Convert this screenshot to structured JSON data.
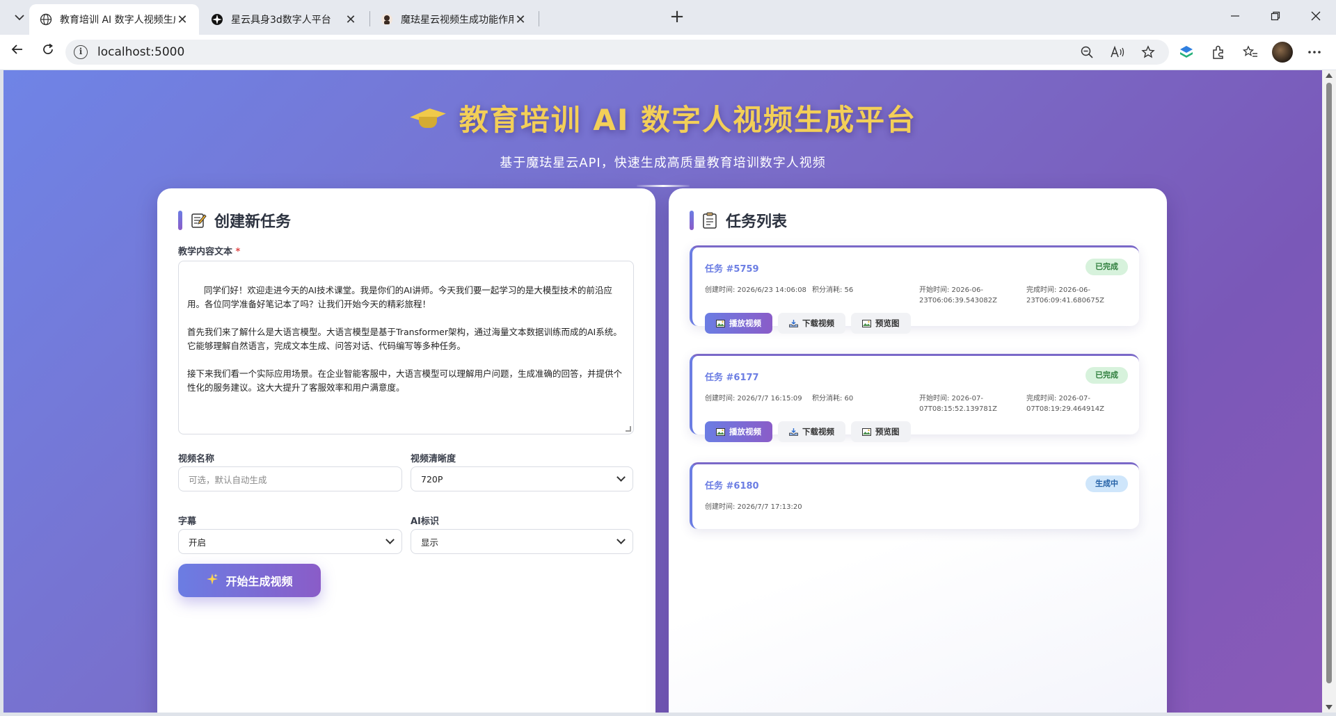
{
  "browser": {
    "tabs": [
      {
        "title": "教育培训 AI 数字人视频生成平台",
        "active": true
      },
      {
        "title": "星云具身3d数字人平台",
        "active": false
      },
      {
        "title": "魔珐星云视频生成功能作用 - 豆包",
        "active": false
      }
    ],
    "url": "localhost:5000"
  },
  "hero": {
    "title": "教育培训 AI 数字人视频生成平台",
    "subtitle": "基于魔珐星云API，快速生成高质量教育培训数字人视频"
  },
  "create": {
    "heading": "创建新任务",
    "content_label": "教学内容文本",
    "required_mark": "*",
    "content_text": "同学们好！欢迎走进今天的AI技术课堂。我是你们的AI讲师。今天我们要一起学习的是大模型技术的前沿应用。各位同学准备好笔记本了吗？让我们开始今天的精彩旅程！\n\n首先我们来了解什么是大语言模型。大语言模型是基于Transformer架构，通过海量文本数据训练而成的AI系统。它能够理解自然语言，完成文本生成、问答对话、代码编写等多种任务。\n\n接下来我们看一个实际应用场景。在企业智能客服中，大语言模型可以理解用户问题，生成准确的回答，并提供个性化的服务建议。这大大提升了客服效率和用户满意度。",
    "video_name_label": "视频名称",
    "video_name_placeholder": "可选，默认自动生成",
    "resolution_label": "视频清晰度",
    "resolution_value": "720P",
    "subtitle_label": "字幕",
    "subtitle_value": "开启",
    "ai_mark_label": "AI标识",
    "ai_mark_value": "显示",
    "submit_label": "开始生成视频"
  },
  "tasks": {
    "heading": "任务列表",
    "items": [
      {
        "id": "任务 #5759",
        "status": "已完成",
        "status_type": "done",
        "created": "创建时间: 2026/6/23 14:06:08",
        "points": "积分消耗: 56",
        "start": "开始时间: 2026-06-\n23T06:06:39.543082Z",
        "finish": "完成时间: 2026-06-\n23T06:09:41.680675Z",
        "actions": [
          "播放视频",
          "下载视频",
          "预览图"
        ]
      },
      {
        "id": "任务 #6177",
        "status": "已完成",
        "status_type": "done",
        "created": "创建时间: 2026/7/7 16:15:09",
        "points": "积分消耗: 60",
        "start": "开始时间: 2026-07-\n07T08:15:52.139781Z",
        "finish": "完成时间: 2026-07-\n07T08:19:29.464914Z",
        "actions": [
          "播放视频",
          "下载视频",
          "预览图"
        ]
      },
      {
        "id": "任务 #6180",
        "status": "生成中",
        "status_type": "running",
        "created": "创建时间: 2026/7/7 17:13:20"
      }
    ]
  },
  "colors": {
    "accent": "#6b7de3",
    "accent2": "#8a5cc8",
    "title_gold": "#f3cf58",
    "done_badge": "#d7f2dc",
    "running_badge": "#cfe6fb"
  }
}
